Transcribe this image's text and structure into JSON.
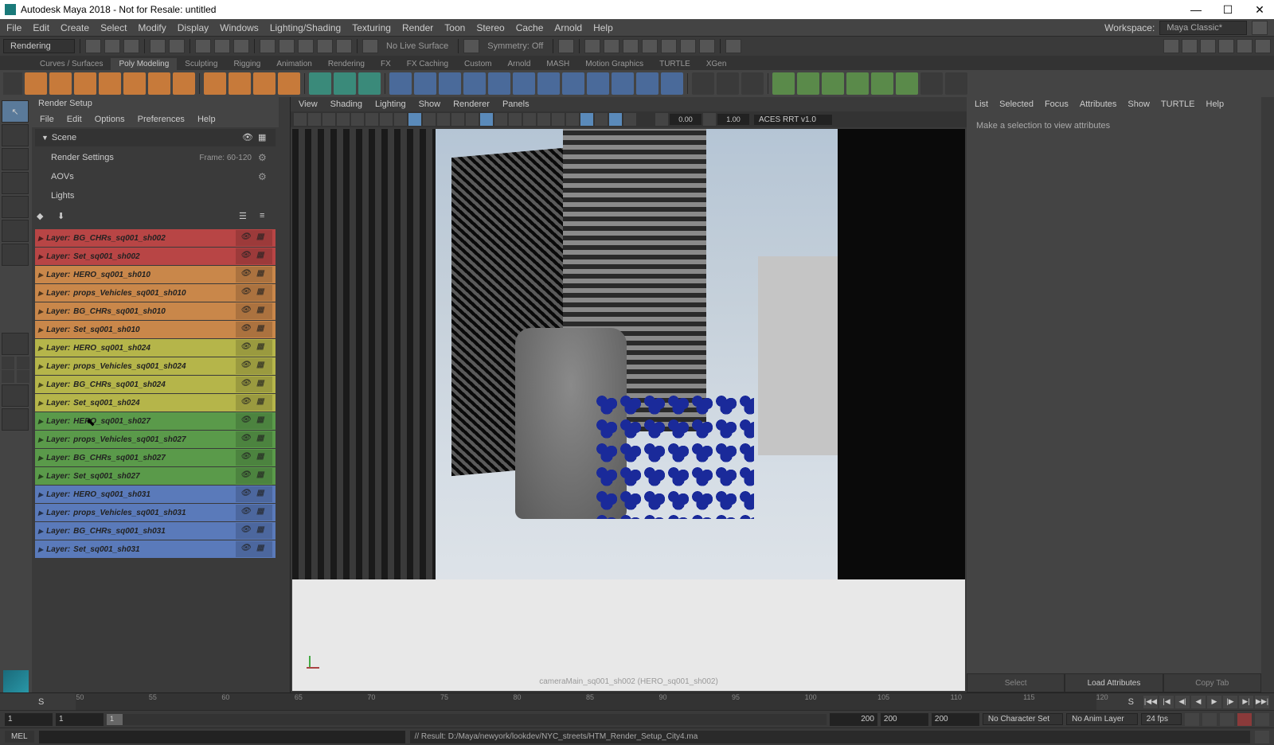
{
  "window": {
    "title": "Autodesk Maya 2018 - Not for Resale: untitled"
  },
  "main_menu": [
    "File",
    "Edit",
    "Create",
    "Select",
    "Modify",
    "Display",
    "Windows",
    "Lighting/Shading",
    "Texturing",
    "Render",
    "Toon",
    "Stereo",
    "Cache",
    "Arnold",
    "Help"
  ],
  "workspace": {
    "label": "Workspace:",
    "value": "Maya Classic*"
  },
  "shelf": {
    "mode": "Rendering",
    "no_live": "No Live Surface",
    "symmetry": "Symmetry: Off"
  },
  "shelf_tabs": [
    "Curves / Surfaces",
    "Poly Modeling",
    "Sculpting",
    "Rigging",
    "Animation",
    "Rendering",
    "FX",
    "FX Caching",
    "Custom",
    "Arnold",
    "MASH",
    "Motion Graphics",
    "TURTLE",
    "XGen"
  ],
  "shelf_tabs_active": 1,
  "render_setup": {
    "title": "Render Setup",
    "menu": [
      "File",
      "Edit",
      "Options",
      "Preferences",
      "Help"
    ],
    "scene": "Scene",
    "render_settings": "Render Settings",
    "frame": "Frame: 60-120",
    "aovs": "AOVs",
    "lights": "Lights",
    "layers": [
      {
        "name": "BG_CHRs_sq001_sh002",
        "color": "c-red"
      },
      {
        "name": "Set_sq001_sh002",
        "color": "c-red"
      },
      {
        "name": "HERO_sq001_sh010",
        "color": "c-orange"
      },
      {
        "name": "props_Vehicles_sq001_sh010",
        "color": "c-orange"
      },
      {
        "name": "BG_CHRs_sq001_sh010",
        "color": "c-orange"
      },
      {
        "name": "Set_sq001_sh010",
        "color": "c-orange"
      },
      {
        "name": "HERO_sq001_sh024",
        "color": "c-yellow"
      },
      {
        "name": "props_Vehicles_sq001_sh024",
        "color": "c-yellow"
      },
      {
        "name": "BG_CHRs_sq001_sh024",
        "color": "c-yellow"
      },
      {
        "name": "Set_sq001_sh024",
        "color": "c-yellow"
      },
      {
        "name": "HERO_sq001_sh027",
        "color": "c-green"
      },
      {
        "name": "props_Vehicles_sq001_sh027",
        "color": "c-green"
      },
      {
        "name": "BG_CHRs_sq001_sh027",
        "color": "c-green"
      },
      {
        "name": "Set_sq001_sh027",
        "color": "c-green"
      },
      {
        "name": "HERO_sq001_sh031",
        "color": "c-blue"
      },
      {
        "name": "props_Vehicles_sq001_sh031",
        "color": "c-blue"
      },
      {
        "name": "BG_CHRs_sq001_sh031",
        "color": "c-blue"
      },
      {
        "name": "Set_sq001_sh031",
        "color": "c-blue"
      }
    ],
    "layer_prefix": "Layer:"
  },
  "viewport": {
    "menu": [
      "View",
      "Shading",
      "Lighting",
      "Show",
      "Renderer",
      "Panels"
    ],
    "val1": "0.00",
    "val2": "1.00",
    "colorspace": "ACES RRT v1.0",
    "camera": "cameraMain_sq001_sh002 (HERO_sq001_sh002)"
  },
  "attr": {
    "menu": [
      "List",
      "Selected",
      "Focus",
      "Attributes",
      "Show",
      "TURTLE",
      "Help"
    ],
    "empty": "Make a selection to view attributes",
    "btn_select": "Select",
    "btn_load": "Load Attributes",
    "btn_copy": "Copy Tab"
  },
  "timeline": {
    "ticks": [
      "50",
      "55",
      "60",
      "65",
      "70",
      "75",
      "80",
      "85",
      "90",
      "95",
      "100",
      "105",
      "110",
      "115",
      "120"
    ],
    "start_marker": "S",
    "end_marker": "S"
  },
  "range": {
    "start_out": "1",
    "start_in": "1",
    "slider_val": "1",
    "end_in": "200",
    "end_out": "200",
    "extra": "200",
    "charset": "No Character Set",
    "animlayer": "No Anim Layer",
    "fps": "24 fps"
  },
  "cmd": {
    "label": "MEL",
    "output": "// Result: D:/Maya/newyork/lookdev/NYC_streets/HTM_Render_Setup_City4.ma"
  }
}
